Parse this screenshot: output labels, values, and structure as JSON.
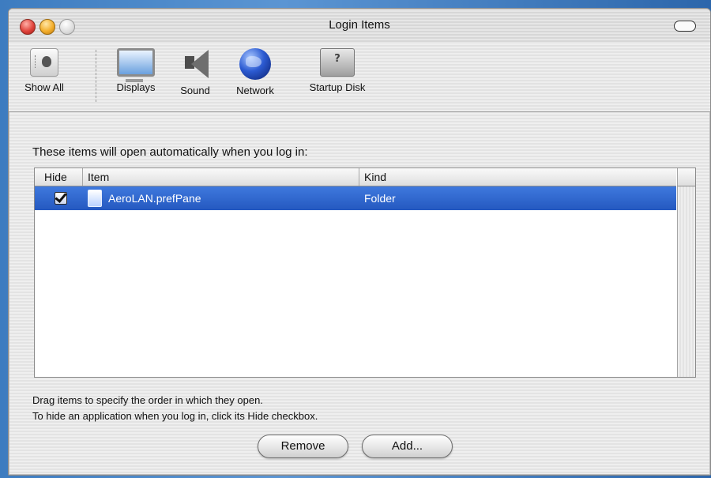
{
  "window": {
    "title": "Login Items"
  },
  "toolbar": {
    "items": [
      {
        "label": "Show All",
        "icon": "show-all-icon"
      },
      {
        "label": "Displays",
        "icon": "display-icon"
      },
      {
        "label": "Sound",
        "icon": "speaker-icon"
      },
      {
        "label": "Network",
        "icon": "globe-icon"
      },
      {
        "label": "Startup Disk",
        "icon": "hard-disk-icon"
      }
    ]
  },
  "main": {
    "intro": "These items will open automatically when you log in:",
    "table": {
      "columns": [
        "Hide",
        "Item",
        "Kind"
      ],
      "rows": [
        {
          "hide": true,
          "item": "AeroLAN.prefPane",
          "kind": "Folder",
          "icon": "folder-icon"
        }
      ]
    },
    "help": [
      "Drag items to specify the order in which they open.",
      "To hide an application when you log in, click its Hide checkbox."
    ],
    "buttons": {
      "remove": "Remove",
      "add": "Add..."
    }
  }
}
